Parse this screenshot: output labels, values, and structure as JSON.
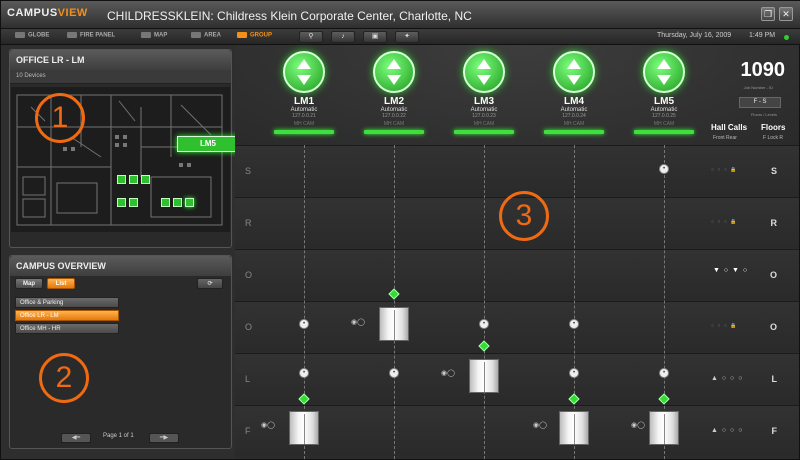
{
  "window": {
    "logo_left": "CAMPUS",
    "logo_right": "VIEW",
    "title": "CHILDRESSKLEIN: Childress Klein Corporate Center, Charlotte, NC"
  },
  "nav": {
    "items": [
      "GLOBE",
      "FIRE PANEL",
      "MAP",
      "AREA",
      "GROUP"
    ],
    "date": "Thursday, July 16, 2009",
    "time": "1:49 PM"
  },
  "left_panel": {
    "title": "OFFICE LR - LM",
    "subtitle": "10 Devices",
    "popup_label": "LM5"
  },
  "campus_overview": {
    "title": "CAMPUS OVERVIEW",
    "tabs": [
      "Map",
      "List"
    ],
    "items": [
      "Office & Parking",
      "Office LR - LM",
      "Office MH - HR"
    ],
    "selected_index": 1,
    "page_text": "Page 1 of 1"
  },
  "annotations": [
    "1",
    "2",
    "3"
  ],
  "elevators": [
    {
      "name": "LM1",
      "mode": "Automatic",
      "ip": "127.0.0.21",
      "tags": "MH  CAM"
    },
    {
      "name": "LM2",
      "mode": "Automatic",
      "ip": "127.0.0.22",
      "tags": "MH  CAM"
    },
    {
      "name": "LM3",
      "mode": "Automatic",
      "ip": "127.0.0.23",
      "tags": "MH  CAM"
    },
    {
      "name": "LM4",
      "mode": "Automatic",
      "ip": "127.0.0.24",
      "tags": "MH  CAM"
    },
    {
      "name": "LM5",
      "mode": "Automatic",
      "ip": "127.0.0.25",
      "tags": "MH  CAM"
    }
  ],
  "group_info": {
    "number": "1090",
    "number_label": "Job Number - ID",
    "range": "F - S",
    "range_label": "Floors / Levels",
    "hall_calls": "Hall Calls",
    "hall_sub": "Front  Rear",
    "floors": "Floors",
    "floors_sub": "F  Lock  R"
  },
  "floors": [
    {
      "label": "S"
    },
    {
      "label": "R"
    },
    {
      "label": "O"
    },
    {
      "label": "O"
    },
    {
      "label": "L"
    },
    {
      "label": "F"
    }
  ]
}
